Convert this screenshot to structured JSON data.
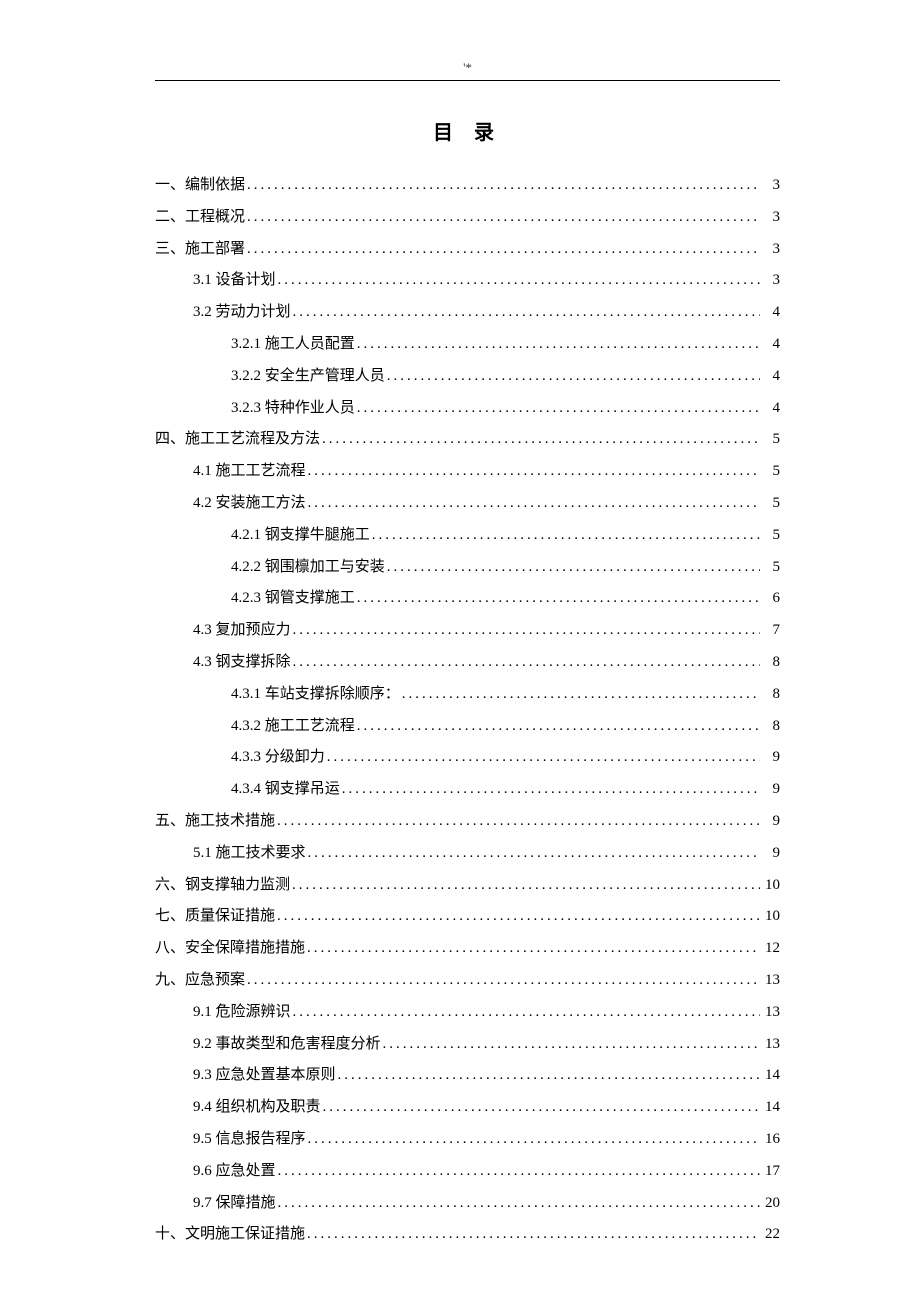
{
  "header_mark": "'*",
  "toc_title": "目 录",
  "entries": [
    {
      "level": 1,
      "label": "一、编制依据",
      "page": "3"
    },
    {
      "level": 1,
      "label": "二、工程概况",
      "page": "3"
    },
    {
      "level": 1,
      "label": "三、施工部署",
      "page": "3"
    },
    {
      "level": 2,
      "label": "3.1 设备计划 ",
      "page": "3"
    },
    {
      "level": 2,
      "label": "3.2 劳动力计划 ",
      "page": "4"
    },
    {
      "level": 3,
      "label": "3.2.1 施工人员配置 ",
      "page": "4"
    },
    {
      "level": 3,
      "label": "3.2.2 安全生产管理人员 ",
      "page": "4"
    },
    {
      "level": 3,
      "label": "3.2.3 特种作业人员 ",
      "page": "4"
    },
    {
      "level": 1,
      "label": "四、施工工艺流程及方法",
      "page": "5"
    },
    {
      "level": 2,
      "label": "4.1 施工工艺流程 ",
      "page": "5"
    },
    {
      "level": 2,
      "label": "4.2 安装施工方法 ",
      "page": "5"
    },
    {
      "level": 3,
      "label": "4.2.1 钢支撑牛腿施工 ",
      "page": "5"
    },
    {
      "level": 3,
      "label": "4.2.2 钢围檩加工与安装 ",
      "page": "5"
    },
    {
      "level": 3,
      "label": "4.2.3 钢管支撑施工 ",
      "page": "6"
    },
    {
      "level": 2,
      "label": "4.3 复加预应力 ",
      "page": "7"
    },
    {
      "level": 2,
      "label": "4.3 钢支撑拆除 ",
      "page": "8"
    },
    {
      "level": 3,
      "label": "4.3.1 车站支撑拆除顺序： ",
      "page": "8"
    },
    {
      "level": 3,
      "label": "4.3.2 施工工艺流程 ",
      "page": "8"
    },
    {
      "level": 3,
      "label": "4.3.3 分级卸力  ",
      "page": "9"
    },
    {
      "level": 3,
      "label": "4.3.4 钢支撑吊运 ",
      "page": "9"
    },
    {
      "level": 1,
      "label": "五、施工技术措施",
      "page": "9"
    },
    {
      "level": 2,
      "label": "5.1 施工技术要求 ",
      "page": "9"
    },
    {
      "level": 1,
      "label": "六、钢支撑轴力监测 ",
      "page": "10"
    },
    {
      "level": 1,
      "label": "七、质量保证措施",
      "page": "10"
    },
    {
      "level": 1,
      "label": "八、安全保障措施措施",
      "page": "12"
    },
    {
      "level": 1,
      "label": "九、应急预案",
      "page": "13"
    },
    {
      "level": 2,
      "label": "9.1 危险源辨识 ",
      "page": "13"
    },
    {
      "level": 2,
      "label": "9.2 事故类型和危害程度分析 ",
      "page": "13"
    },
    {
      "level": 2,
      "label": "9.3 应急处置基本原则 ",
      "page": "14"
    },
    {
      "level": 2,
      "label": "9.4 组织机构及职责 ",
      "page": "14"
    },
    {
      "level": 2,
      "label": "9.5 信息报告程序 ",
      "page": "16"
    },
    {
      "level": 2,
      "label": "9.6 应急处置 ",
      "page": "17"
    },
    {
      "level": 2,
      "label": "9.7 保障措施 ",
      "page": "20"
    },
    {
      "level": 1,
      "label": "十、文明施工保证措施",
      "page": "22"
    }
  ]
}
